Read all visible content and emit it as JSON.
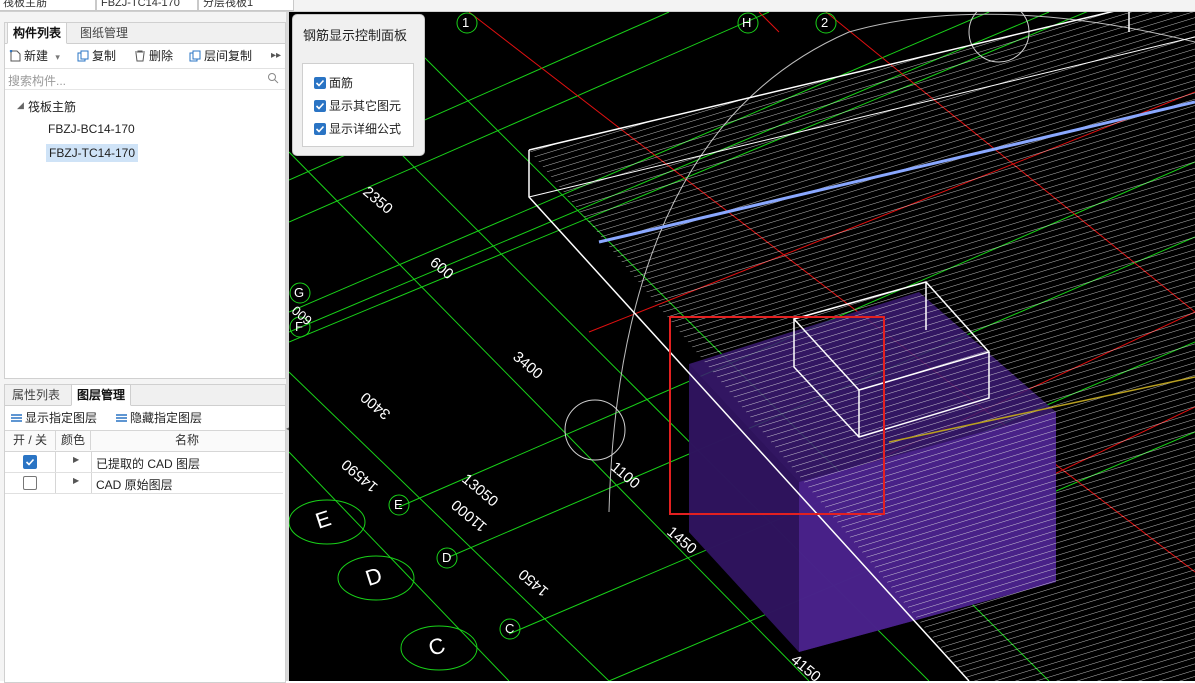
{
  "topbar": {
    "combo1": "筏板主筋",
    "combo2": "FBZJ-TC14-170",
    "combo3": "分层筏板1"
  },
  "component_panel": {
    "tabs": [
      "构件列表",
      "图纸管理"
    ],
    "toolbar": {
      "new": "新建",
      "copy": "复制",
      "delete": "删除",
      "floor_copy": "层间复制"
    },
    "search_placeholder": "搜索构件...",
    "tree": {
      "root": "筏板主筋",
      "items": [
        "FBZJ-BC14-170",
        "FBZJ-TC14-170"
      ],
      "selected": "FBZJ-TC14-170"
    }
  },
  "layer_panel": {
    "tabs": [
      "属性列表",
      "图层管理"
    ],
    "toolbar": {
      "show": "显示指定图层",
      "hide": "隐藏指定图层"
    },
    "columns": [
      "开 / 关",
      "颜色",
      "名称"
    ],
    "rows": [
      {
        "name": "已提取的 CAD 图层",
        "on": true
      },
      {
        "name": "CAD 原始图层",
        "on": false
      }
    ]
  },
  "control_panel": {
    "title": "钢筋显示控制面板",
    "options": [
      {
        "label": "面筋",
        "checked": true
      },
      {
        "label": "显示其它图元",
        "checked": true
      },
      {
        "label": "显示详细公式",
        "checked": true
      }
    ]
  },
  "viewport": {
    "axis_labels": [
      "1",
      "H",
      "2",
      "G",
      "F",
      "E",
      "D",
      "C"
    ],
    "dimensions": [
      "2350",
      "600",
      "3400",
      "3400",
      "14590",
      "13050",
      "11000",
      "1100",
      "1450",
      "1450",
      "4150",
      "600"
    ],
    "colors": {
      "grid_green": "#19d219",
      "axis_red": "#e01010",
      "rebar_white": "#ffffff",
      "slab_blue": "#8aa8ff",
      "footing_purple": "#5b2a9a",
      "highlight_red": "#e32020",
      "checkbox_blue": "#2a74c4"
    }
  }
}
